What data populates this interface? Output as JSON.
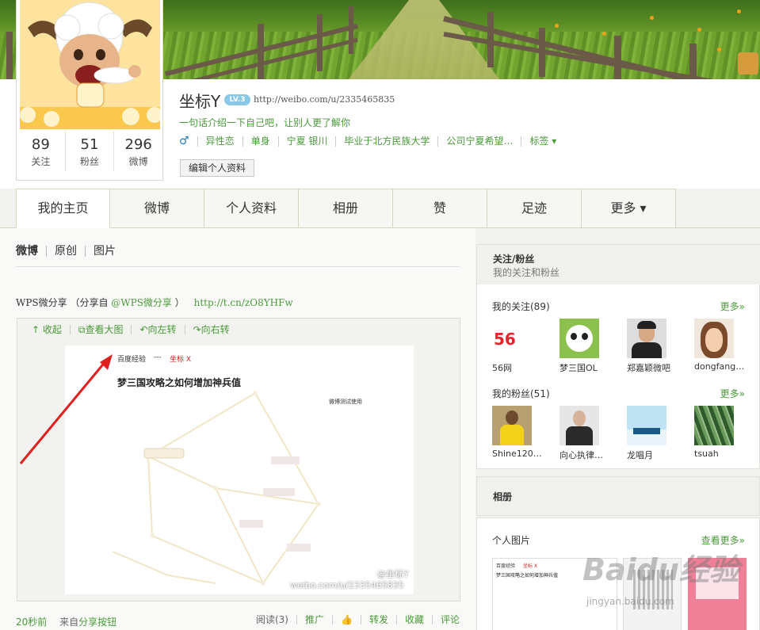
{
  "profile": {
    "name": "坐标Y",
    "level_badge": "LV.3",
    "url": "http://weibo.com/u/2335465835",
    "intro": "一句话介绍一下自己吧，让别人更了解你",
    "gender_icon": "♂",
    "info": [
      "异性恋",
      "单身",
      "宁夏 银川",
      "毕业于北方民族大学",
      "公司宁夏希望…",
      "标签 ▾"
    ],
    "edit_button": "编辑个人资料",
    "stats": [
      {
        "num": "89",
        "label": "关注"
      },
      {
        "num": "51",
        "label": "粉丝"
      },
      {
        "num": "296",
        "label": "微博"
      }
    ]
  },
  "nav": {
    "tabs": [
      "我的主页",
      "微博",
      "个人资料",
      "相册",
      "赞",
      "足迹",
      "更多 ▾"
    ],
    "active": 0
  },
  "feed": {
    "tabs": [
      "微博",
      "原创",
      "图片"
    ],
    "post": {
      "text_prefix": "WPS微分享 （分享自",
      "mention": "@WPS微分享",
      "text_suffix": "）",
      "link": "http://t.cn/zO8YHFw"
    },
    "media_tools": [
      "收起",
      "查看大图",
      "向左转",
      "向右转"
    ],
    "image": {
      "source": "百度经验",
      "sep": "---",
      "author": "坐标 X",
      "title": "梦三国攻略之如何增加神兵值",
      "note": "微博测试使用",
      "watermark_handle": "@坐标Y",
      "watermark_url": "weibo.com/u/2335465835"
    },
    "footer": {
      "time": "20秒前",
      "from_prefix": "来自",
      "from_app": "分享按钮",
      "actions": [
        "阅读(3)",
        "推广",
        "👍",
        "转发",
        "收藏",
        "评论"
      ]
    }
  },
  "sidebar": {
    "follow_box": {
      "title": "关注/粉丝",
      "subtitle": "我的关注和粉丝",
      "following_title": "我的关注(89)",
      "following_more": "更多»",
      "following": [
        {
          "name": "56网",
          "avatar": "56-logo",
          "avatar_text": "56"
        },
        {
          "name": "梦三国OL",
          "avatar": "panda-avatar"
        },
        {
          "name": "郑嘉颖微吧",
          "avatar": "man-avatar"
        },
        {
          "name": "dongfang…",
          "avatar": "cartoon-girl-avatar"
        }
      ],
      "fans_title": "我的粉丝(51)",
      "fans_more": "更多»",
      "fans": [
        {
          "name": "Shine120…",
          "avatar": "yellow-shirt-avatar"
        },
        {
          "name": "向心执律…",
          "avatar": "dark-suit-avatar"
        },
        {
          "name": "龙唱月",
          "avatar": "blue-scene-avatar"
        },
        {
          "name": "tsuah",
          "avatar": "forest-avatar"
        }
      ]
    },
    "album_box": {
      "title": "相册"
    },
    "photos_box": {
      "title": "个人图片",
      "more": "查看更多»"
    }
  },
  "watermark": {
    "brand": "Baidu经验",
    "sub": "jingyan.baidu.com"
  },
  "colors": {
    "accent": "#4a9a3a",
    "nav_border": "#cfd8c0",
    "author_red": "#d02020",
    "arrow_red": "#e02020"
  }
}
